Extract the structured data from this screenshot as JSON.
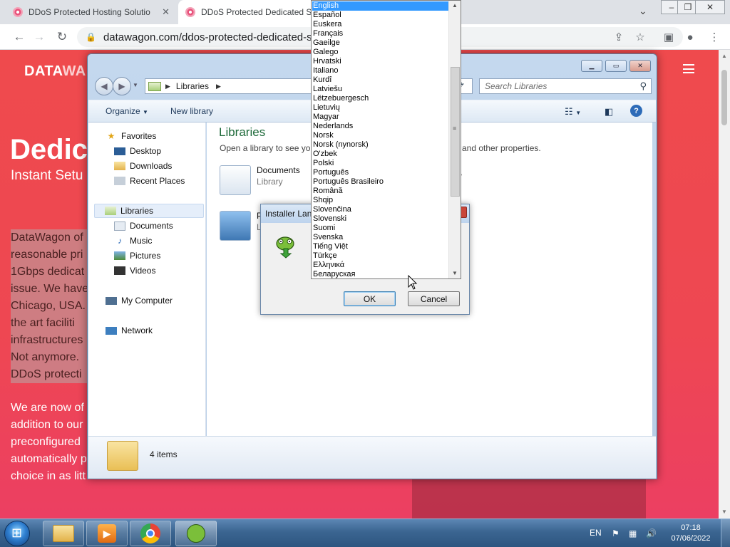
{
  "browser": {
    "tabs": [
      {
        "title": "DDoS Protected Hosting Solutio",
        "close": "✕"
      },
      {
        "title": "DDoS Protected Dedicated Se",
        "close": "✕"
      }
    ],
    "url": "datawagon.com/ddos-protected-dedicated-serv"
  },
  "website": {
    "logo_bold": "DATA",
    "logo_light": "WA",
    "hero_title": "Dedic",
    "hero_subtitle": "Instant Setu",
    "para1": [
      "DataWagon of",
      "reasonable pri",
      "1Gbps dedicat",
      "issue. We have",
      "Chicago, USA.",
      "the art faciliti",
      "infrastructures",
      "Not anymore.",
      "DDoS protecti"
    ],
    "para2": [
      "We are now of",
      "addition to our",
      "preconfigured",
      "automatically p",
      "choice in as litt"
    ]
  },
  "explorer": {
    "breadcrumb": "Libraries",
    "search_placeholder": "Search Libraries",
    "toolbar": {
      "organize": "Organize",
      "new_library": "New library"
    },
    "nav": {
      "favorites": "Favorites",
      "favorites_items": [
        "Desktop",
        "Downloads",
        "Recent Places"
      ],
      "libraries": "Libraries",
      "libraries_items": [
        "Documents",
        "Music",
        "Pictures",
        "Videos"
      ],
      "computer": "My Computer",
      "network": "Network"
    },
    "content": {
      "title": "Libraries",
      "subtitle": "Open a library to see you",
      "subtitle_tail": "and other properties.",
      "items": [
        {
          "name": "Documents",
          "type": "Library"
        },
        {
          "name": "P",
          "type": "L"
        }
      ],
      "tail_text": "y"
    },
    "details": {
      "count": "4 items"
    }
  },
  "installer": {
    "title": "Installer Lan",
    "ok": "OK",
    "cancel": "Cancel"
  },
  "languages": {
    "selected": "English",
    "options": [
      "English",
      "Español",
      "Euskera",
      "Français",
      "Gaeilge",
      "Galego",
      "Hrvatski",
      "Italiano",
      "Kurdî",
      "Latviešu",
      "Lëtzebuergesch",
      "Lietuvių",
      "Magyar",
      "Nederlands",
      "Norsk",
      "Norsk (nynorsk)",
      "O'zbek",
      "Polski",
      "Português",
      "Português Brasileiro",
      "Română",
      "Shqip",
      "Slovenčina",
      "Slovenski",
      "Suomi",
      "Svenska",
      "Tiếng Việt",
      "Türkçe",
      "Ελληνικά",
      "Беларуская"
    ]
  },
  "taskbar": {
    "lang": "EN",
    "time": "07:18",
    "date": "07/06/2022"
  },
  "colors": {
    "page_red": "#ef4a4d",
    "selection_blue": "#3399ff",
    "library_green": "#1e6a3a"
  }
}
